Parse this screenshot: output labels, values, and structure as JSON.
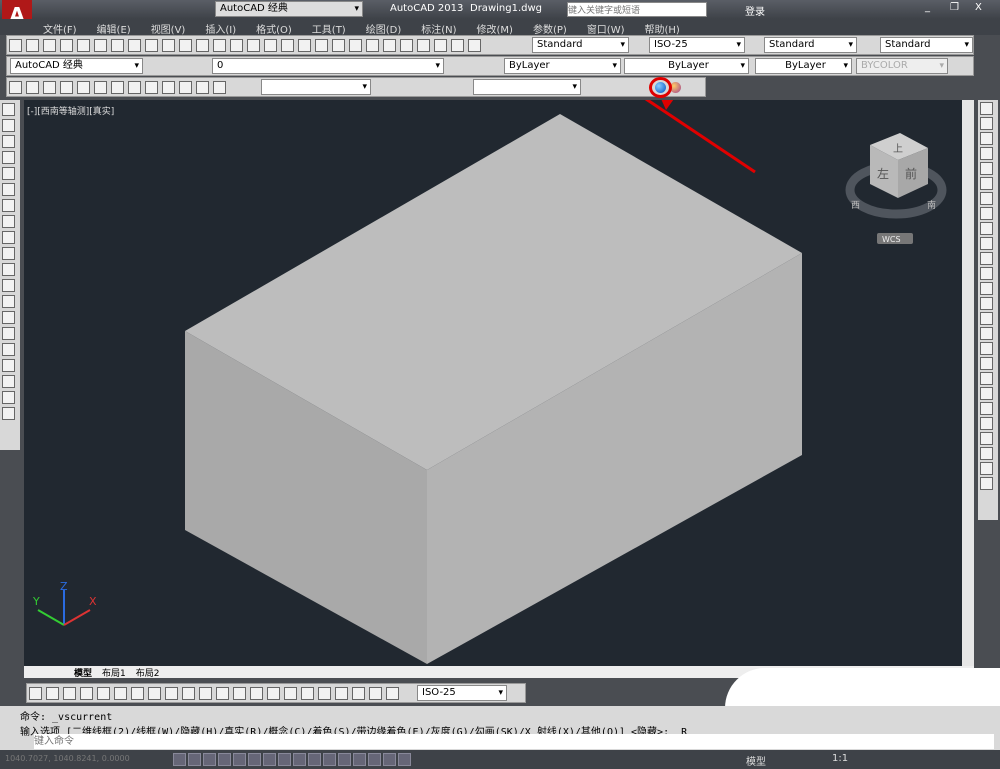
{
  "title_bar": {
    "workspace": "AutoCAD 经典",
    "app_title": "AutoCAD 2013",
    "file": "Drawing1.dwg",
    "search_placeholder": "键入关键字或短语",
    "login": "登录"
  },
  "menu": [
    "文件(F)",
    "编辑(E)",
    "视图(V)",
    "插入(I)",
    "格式(O)",
    "工具(T)",
    "绘图(D)",
    "标注(N)",
    "修改(M)",
    "参数(P)",
    "窗口(W)",
    "帮助(H)"
  ],
  "styles": {
    "text_style": "Standard",
    "dim_style": "ISO-25",
    "table_style": "Standard",
    "multileader_style": "Standard"
  },
  "layers": {
    "workspace": "AutoCAD 经典",
    "layer": "0",
    "color": "ByLayer",
    "linetype": "ByLayer",
    "lineweight": "ByLayer",
    "plotstyle": "BYCOLOR"
  },
  "viewport": {
    "label": "[-][西南等轴测][真实]",
    "viewcube": {
      "top": "上",
      "left": "左",
      "front": "前",
      "west": "西",
      "south": "南",
      "wcs": "WCS"
    },
    "axes": {
      "x": "X",
      "y": "Y",
      "z": "Z"
    },
    "box_colors": {
      "top": "#bdbdbd",
      "left": "#a9a9a9",
      "right": "#b3b3b3"
    },
    "highlight": "#e00000"
  },
  "layout_tabs": [
    "模型",
    "布局1",
    "布局2"
  ],
  "dim_toolbar": {
    "dim_style": "ISO-25"
  },
  "command": {
    "line1": "命令: _vscurrent",
    "line2": "输入选项 [二维线框(2)/线框(W)/隐藏(H)/真实(R)/概念(C)/着色(S)/带边缘着色(E)/灰度(G)/勾画(SK)/X 射线(X)/其他(O)] <隐藏>: _R",
    "placeholder": "键入命令"
  },
  "status": {
    "coords": "1040.7027, 1040.8241, 0.0000",
    "model": "模型",
    "scale": "1:1"
  }
}
